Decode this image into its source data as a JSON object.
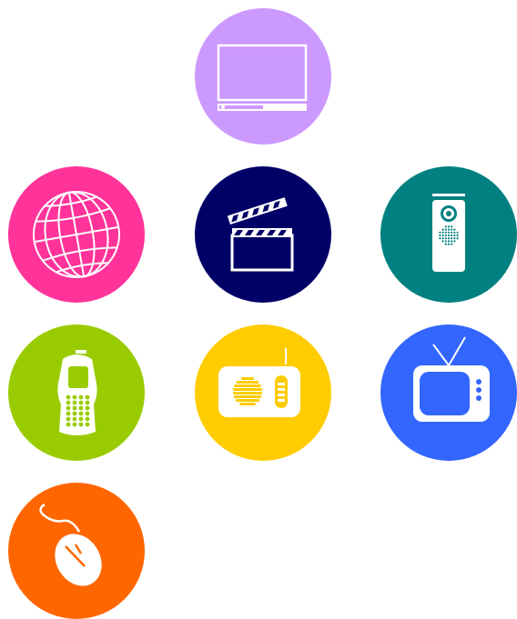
{
  "colors": {
    "desktop": "#cc99ff",
    "web": "#ff3399",
    "film": "#000066",
    "speaker": "#008080",
    "mobile": "#99cc00",
    "radio": "#ffcc00",
    "tv": "#3366ff",
    "mouse": "#ff6600",
    "icon": "#ffffff"
  },
  "tiles": [
    {
      "id": "desktop",
      "icon": "monitor-icon"
    },
    {
      "id": "web",
      "icon": "globe-icon"
    },
    {
      "id": "film",
      "icon": "clapperboard-icon"
    },
    {
      "id": "speaker",
      "icon": "speaker-icon"
    },
    {
      "id": "mobile",
      "icon": "mobile-phone-icon"
    },
    {
      "id": "radio",
      "icon": "radio-icon"
    },
    {
      "id": "tv",
      "icon": "tv-icon"
    },
    {
      "id": "mouse",
      "icon": "computer-mouse-icon"
    }
  ]
}
